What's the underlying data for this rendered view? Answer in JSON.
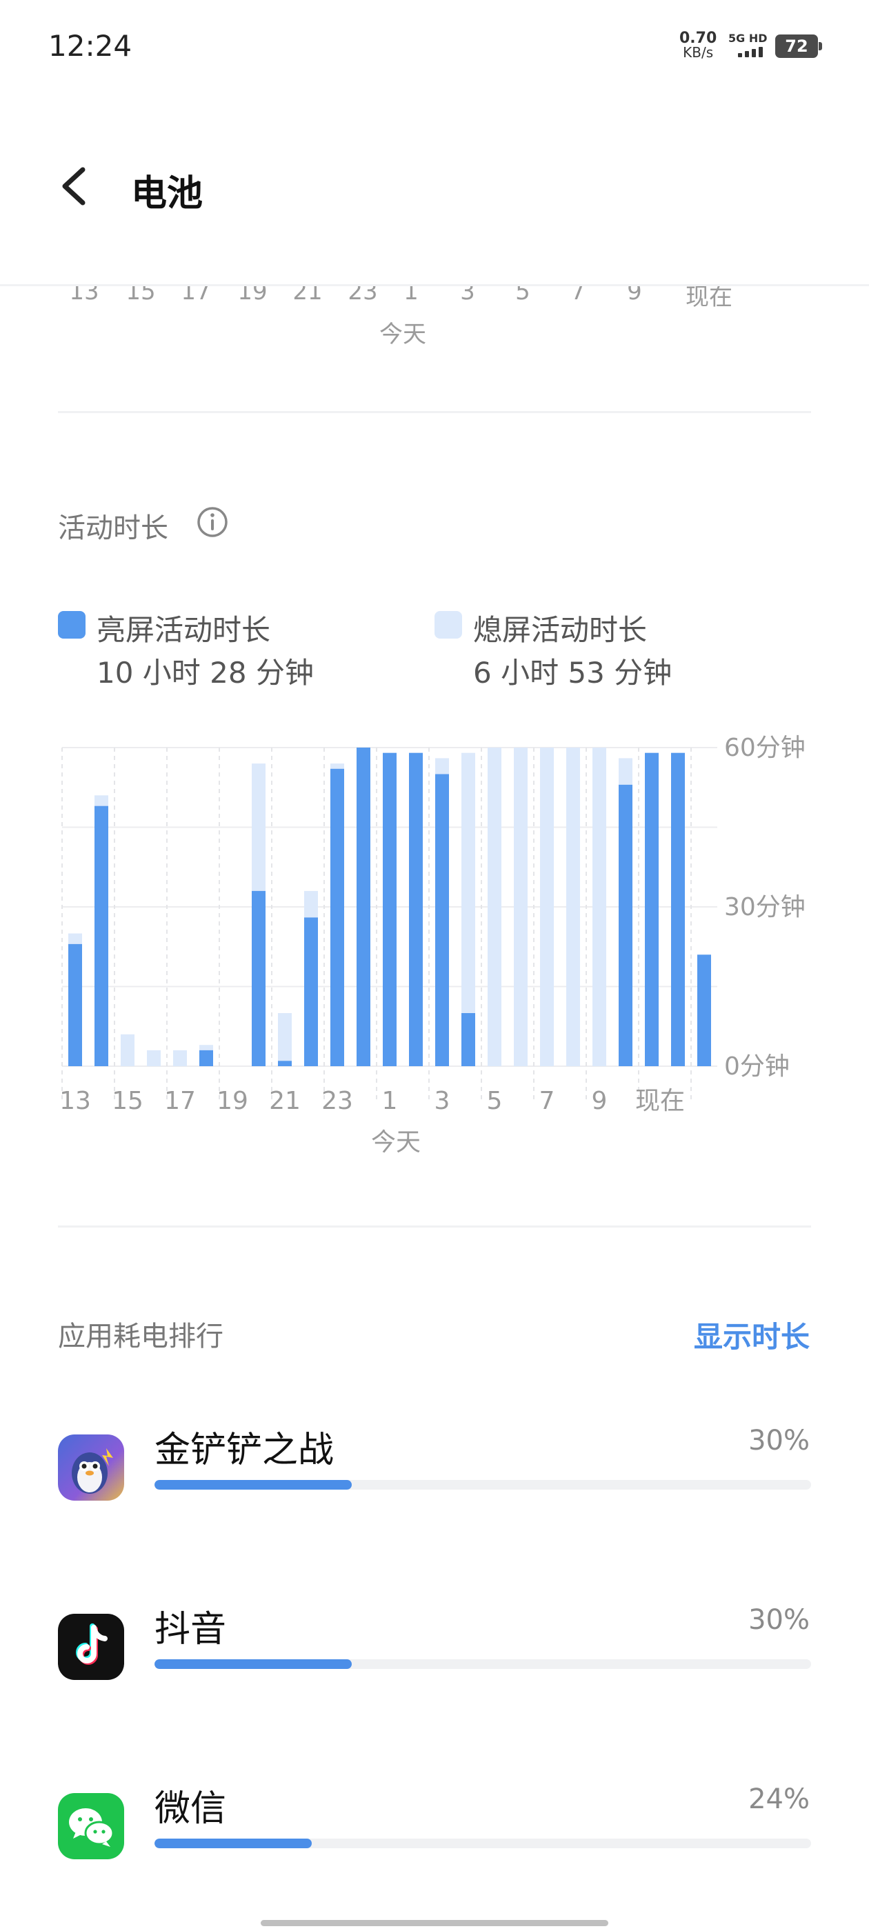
{
  "status_bar": {
    "time": "12:24",
    "net_speed_value": "0.70",
    "net_speed_unit": "KB/s",
    "signal_label": "5G HD",
    "battery_level": "72"
  },
  "header": {
    "title": "电池"
  },
  "top_axis": {
    "ticks": [
      "13",
      "15",
      "17",
      "19",
      "21",
      "23",
      "1",
      "3",
      "5",
      "7",
      "9",
      "现在"
    ],
    "sublabel": "今天"
  },
  "activity": {
    "title": "活动时长",
    "legend": [
      {
        "name": "亮屏活动时长",
        "value": "10 小时 28 分钟",
        "color": "#5599ee"
      },
      {
        "name": "熄屏活动时长",
        "value": "6 小时 53 分钟",
        "color": "#dce9fb"
      }
    ]
  },
  "chart_data": {
    "type": "bar",
    "stacked": true,
    "categories": [
      "13",
      "14",
      "15",
      "16",
      "17",
      "18",
      "19",
      "20",
      "21",
      "22",
      "23",
      "0",
      "1",
      "2",
      "3",
      "4",
      "5",
      "6",
      "7",
      "8",
      "9",
      "10",
      "11",
      "12"
    ],
    "tick_labels": [
      "13",
      "15",
      "17",
      "19",
      "21",
      "23",
      "1",
      "3",
      "5",
      "7",
      "9",
      "现在"
    ],
    "x_sublabel": "今天",
    "y_ticks": [
      "60分钟",
      "30分钟",
      "0分钟"
    ],
    "ylim": [
      0,
      60
    ],
    "series": [
      {
        "name": "亮屏活动时长",
        "color": "#5599ee",
        "values": [
          23,
          49,
          0,
          0,
          0,
          3,
          0,
          33,
          1,
          28,
          56,
          60,
          59,
          59,
          55,
          10,
          0,
          0,
          0,
          0,
          0,
          53,
          59,
          59,
          21
        ]
      },
      {
        "name": "熄屏活动时长",
        "color": "#dce9fb",
        "values": [
          2,
          2,
          6,
          3,
          3,
          1,
          0,
          24,
          9,
          5,
          1,
          0,
          0,
          0,
          3,
          49,
          60,
          60,
          60,
          60,
          60,
          5,
          0,
          0,
          0
        ]
      }
    ]
  },
  "ranking": {
    "title": "应用耗电排行",
    "toggle_label": "显示时长",
    "apps": [
      {
        "name": "金铲铲之战",
        "percent": "30%",
        "fraction": 0.3,
        "icon": "game-app-icon"
      },
      {
        "name": "抖音",
        "percent": "30%",
        "fraction": 0.3,
        "icon": "douyin-app-icon"
      },
      {
        "name": "微信",
        "percent": "24%",
        "fraction": 0.24,
        "icon": "wechat-app-icon"
      }
    ]
  }
}
